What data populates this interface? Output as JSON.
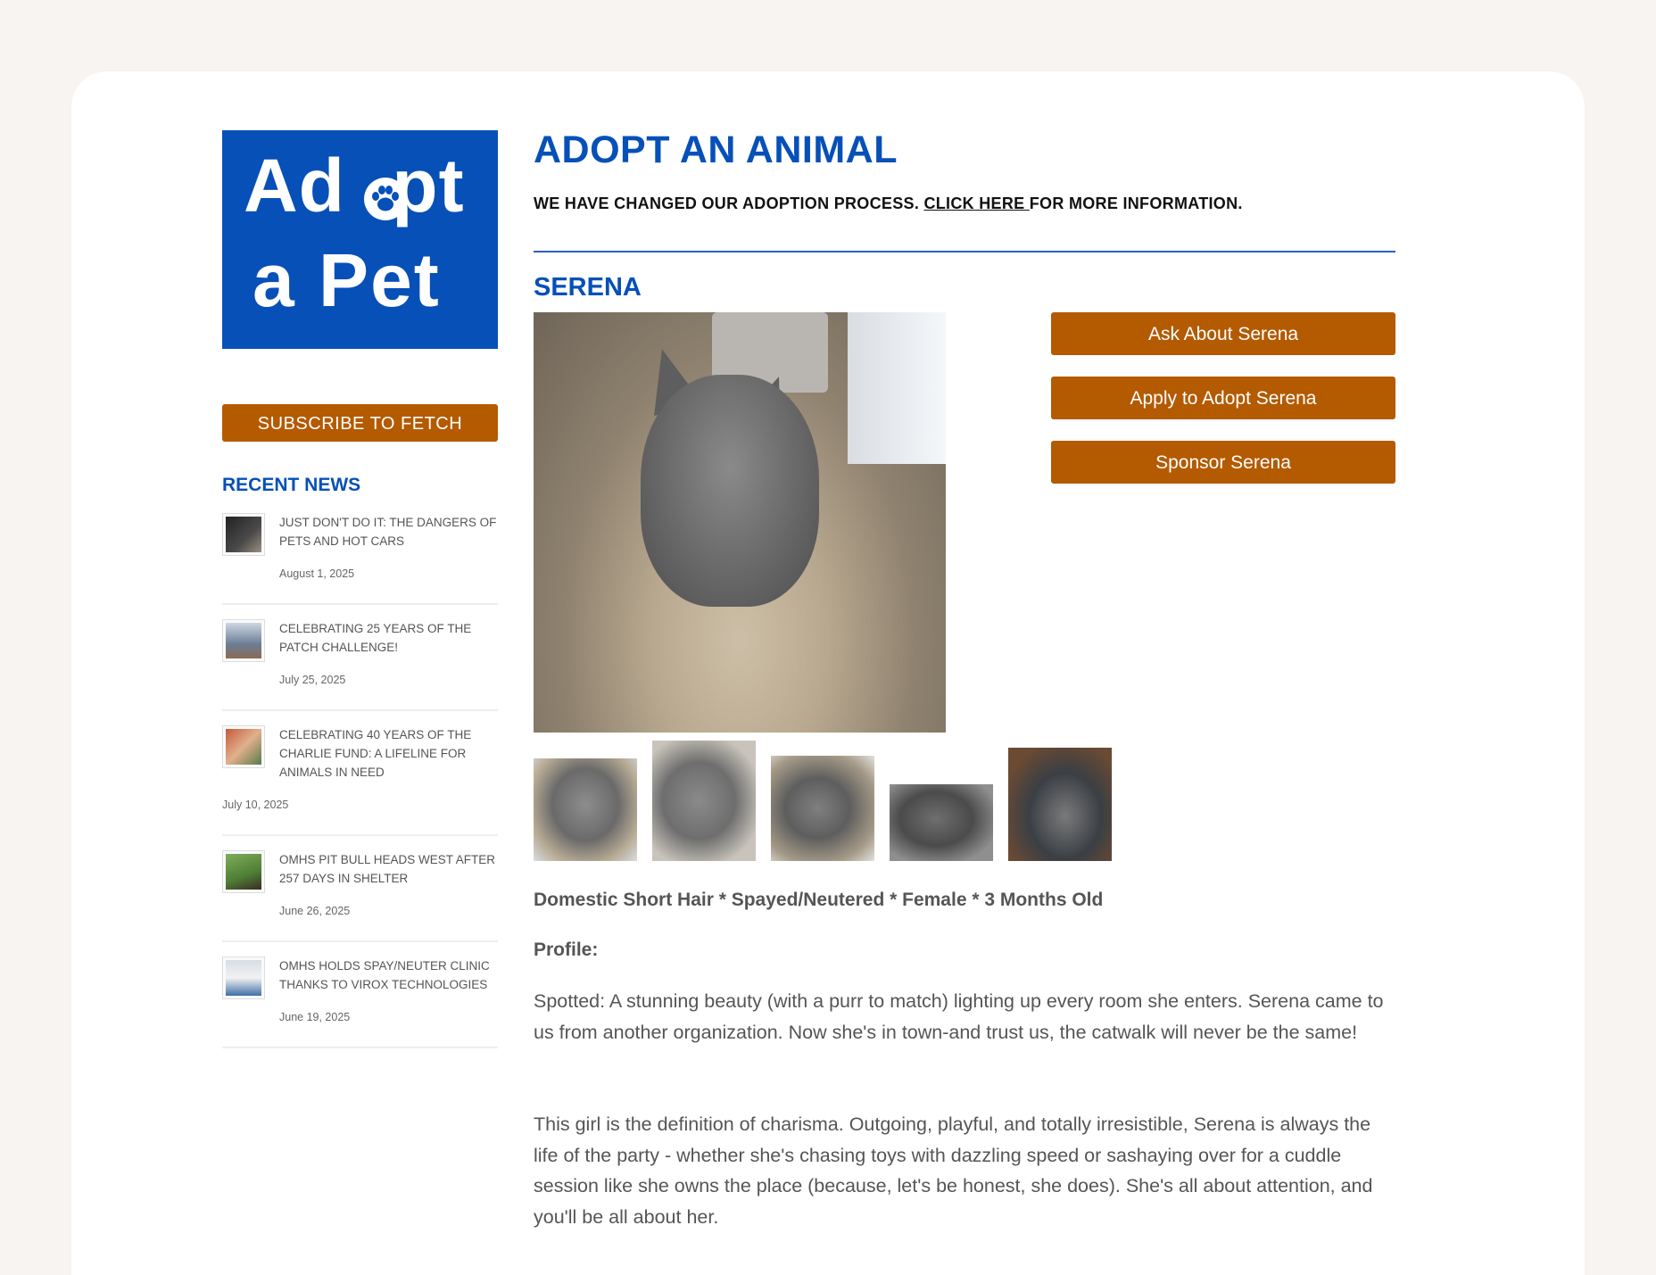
{
  "logo": {
    "line1": "Adopt",
    "line2": "a  Pet",
    "brand_color": "#0650b8"
  },
  "sidebar": {
    "subscribe_label": "SUBSCRIBE TO FETCH",
    "recent_news_title": "RECENT NEWS",
    "news": [
      {
        "title": "JUST DON'T DO IT: THE DANGERS OF PETS AND HOT CARS",
        "date": "August 1, 2025"
      },
      {
        "title": "CELEBRATING 25 YEARS OF THE PATCH CHALLENGE!",
        "date": "July 25, 2025"
      },
      {
        "title": "CELEBRATING 40 YEARS OF THE CHARLIE FUND: A LIFELINE FOR ANIMALS IN NEED",
        "date": "July 10, 2025"
      },
      {
        "title": "OMHS PIT BULL HEADS WEST AFTER 257 DAYS IN SHELTER",
        "date": "June 26, 2025"
      },
      {
        "title": "OMHS HOLDS SPAY/NEUTER CLINIC THANKS TO VIROX TECHNOLOGIES",
        "date": "June 19, 2025"
      }
    ]
  },
  "main": {
    "title": "ADOPT AN ANIMAL",
    "notice_prefix": "WE HAVE CHANGED OUR ADOPTION PROCESS. ",
    "notice_link": "CLICK HERE ",
    "notice_suffix": "FOR MORE INFORMATION.",
    "pet_name": "SERENA",
    "actions": [
      "Ask About Serena",
      "Apply to Adopt Serena",
      "Sponsor Serena"
    ],
    "specs": "Domestic Short Hair * Spayed/Neutered * Female * 3 Months Old",
    "profile_label": "Profile:",
    "paragraphs": [
      "Spotted: A stunning beauty (with a purr to match) lighting up every room she enters. Serena came to us from another organization. Now she's in town-and trust us, the catwalk will never be the same!",
      "This girl is the definition of charisma. Outgoing, playful, and totally irresistible, Serena is always the life of the party - whether she's chasing toys with dazzling speed or sashaying over for a cuddle session like she owns the place (because, let's be honest, she does). She's all about attention, and you'll be all about her."
    ]
  },
  "colors": {
    "accent_orange": "#b45a00",
    "heading_blue": "#0650b8"
  }
}
